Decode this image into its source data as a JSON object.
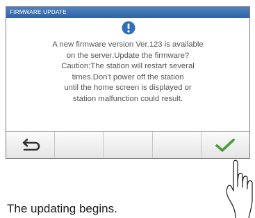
{
  "dialog": {
    "title": "FIRMWARE UPDATE",
    "icon": "info-icon",
    "message_lines": [
      "A new firmware version Ver.123 is available",
      "on the server.Update the firmware?",
      "Caution:The station will restart several",
      "times.Don't power off the station",
      "until the home screen is displayed or",
      "station malfunction could result."
    ]
  },
  "buttons": {
    "back": {
      "icon": "back-arrow-icon"
    },
    "confirm": {
      "icon": "checkmark-icon"
    }
  },
  "caption": "The updating begins.",
  "colors": {
    "title_bar": "#3a6fb2",
    "accent": "#2f6fba",
    "checkmark": "#4a9a3c",
    "text": "#555555"
  }
}
